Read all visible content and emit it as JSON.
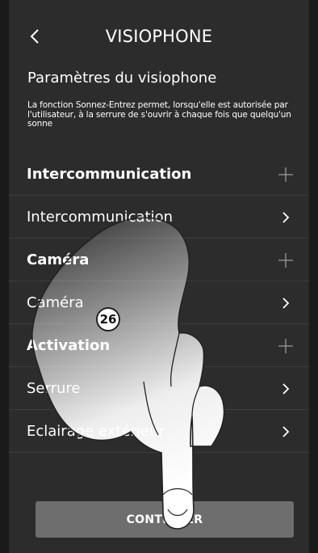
{
  "header": {
    "title": "VISIOPHONE",
    "back_icon": "chevron-left-icon"
  },
  "section": {
    "title": "Paramètres du visiophone",
    "description": "La fonction Sonnez-Entrez permet, lorsqu'elle est autorisée par l'utilisateur, à la serrure de s'ouvrir à chaque fois que quelqu'un sonne"
  },
  "rows": [
    {
      "label": "Intercommunication",
      "kind": "group",
      "icon": "plus-icon"
    },
    {
      "label": "Intercommunication",
      "kind": "item",
      "icon": "chevron-right-icon"
    },
    {
      "label": "Caméra",
      "kind": "group",
      "icon": "plus-icon"
    },
    {
      "label": "Caméra",
      "kind": "item",
      "icon": "chevron-right-icon"
    },
    {
      "label": "Activation",
      "kind": "group",
      "icon": "plus-icon"
    },
    {
      "label": "Serrure",
      "kind": "item",
      "icon": "chevron-right-icon"
    },
    {
      "label": "Eclairage extérieur",
      "kind": "item",
      "icon": "chevron-right-icon"
    }
  ],
  "continue_button": {
    "label": "CONTINUER"
  },
  "annotation": {
    "step_number": "26"
  },
  "colors": {
    "background": "#2c2c2c",
    "divider": "#3d3d3d",
    "button": "#6e6e6e",
    "text": "#ffffff"
  }
}
